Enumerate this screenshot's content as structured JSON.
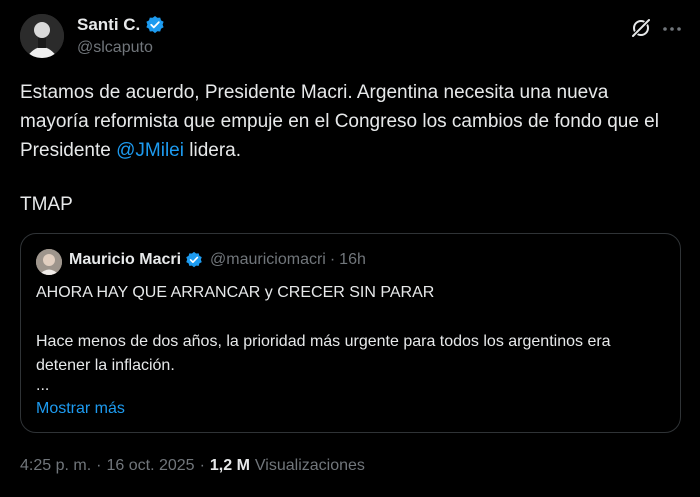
{
  "author": {
    "name": "Santi C.",
    "handle": "@slcaputo",
    "avatar_icon": "avatar-photo"
  },
  "body": {
    "part1": "Estamos de acuerdo, Presidente Macri. Argentina necesita una nueva mayoría reformista que empuje en el Congreso los cambios de fondo que el Presidente ",
    "mention": "@JMilei",
    "part2": " lidera.",
    "tmap": "TMAP"
  },
  "quote": {
    "name": "Mauricio Macri",
    "handle": "@mauriciomacri",
    "separator": "·",
    "time": "16h",
    "line1": "AHORA HAY QUE ARRANCAR y CRECER SIN PARAR",
    "paragraph": "Hace menos de dos años, la prioridad más urgente para todos los argentinos era detener la inflación.",
    "ellipsis": "...",
    "show_more": "Mostrar más"
  },
  "meta": {
    "time": "4:25 p. m.",
    "separator1": "·",
    "date": "16 oct. 2025",
    "separator2": "·",
    "views_count": "1,2 M",
    "views_label": "Visualizaciones"
  },
  "colors": {
    "background": "#000000",
    "text": "#e7e9ea",
    "secondary": "#71767b",
    "accent": "#1d9bf0",
    "border": "#2f3336"
  }
}
